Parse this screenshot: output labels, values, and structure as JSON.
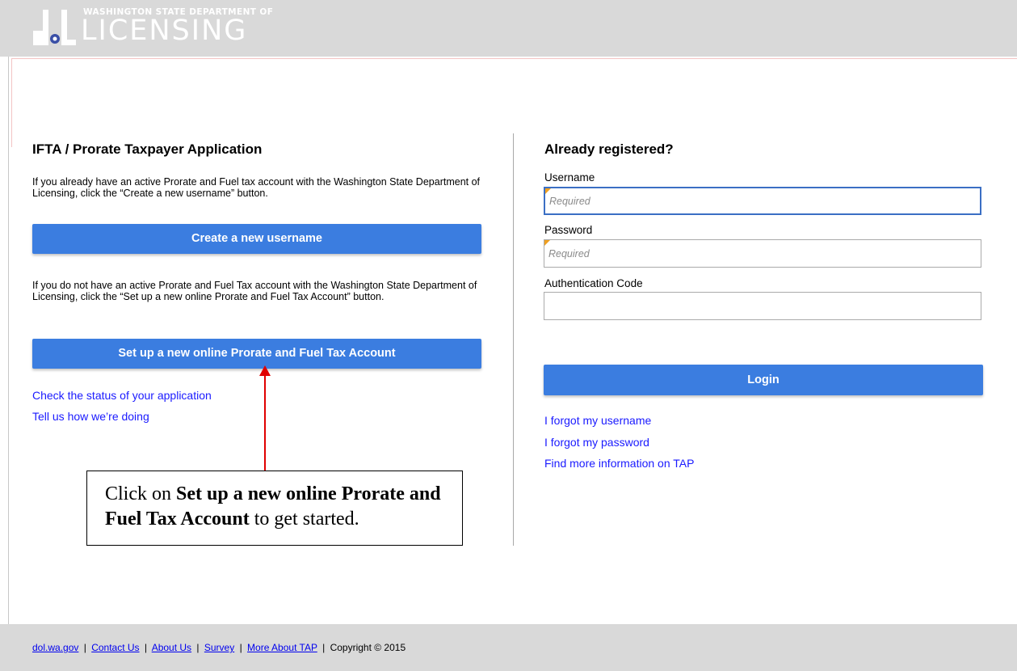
{
  "header": {
    "dept_text": "WASHINGTON STATE DEPARTMENT OF",
    "brand_text": "LICENSING"
  },
  "left": {
    "title": "IFTA / Prorate Taxpayer Application",
    "intro_existing": "If you already have an active Prorate and Fuel tax account with the Washington State Department of Licensing, click the “Create a new username” button.",
    "create_button": "Create a new username",
    "intro_new": "If you do not have an active Prorate and Fuel Tax account with the Washington State Department of Licensing, click the “Set up a new online Prorate and Fuel Tax Account” button.",
    "setup_button": "Set up a new online Prorate and Fuel Tax Account",
    "link_status": "Check the status of your application",
    "link_feedback": "Tell us how we’re doing"
  },
  "right": {
    "title": "Already registered?",
    "username_label": "Username",
    "username_placeholder": "Required",
    "password_label": "Password",
    "password_placeholder": "Required",
    "auth_label": "Authentication Code",
    "login_button": "Login",
    "link_forgot_username": "I forgot my username",
    "link_forgot_password": "I forgot my password",
    "link_tap_info": "Find more information on TAP"
  },
  "callout": {
    "prefix": "Click on ",
    "bold": "Set up a new online Prorate and Fuel Tax Account",
    "suffix": " to get started."
  },
  "footer": {
    "link_dol": "dol.wa.gov",
    "link_contact": "Contact Us",
    "link_about": "About Us",
    "link_survey": "Survey",
    "link_more": "More About TAP",
    "copyright": "Copyright © 2015",
    "separator": "|"
  },
  "colors": {
    "button_blue": "#3b7de0",
    "link_blue": "#1a1aff",
    "header_gray": "#d9d9d9",
    "arrow_red": "#e00000"
  }
}
